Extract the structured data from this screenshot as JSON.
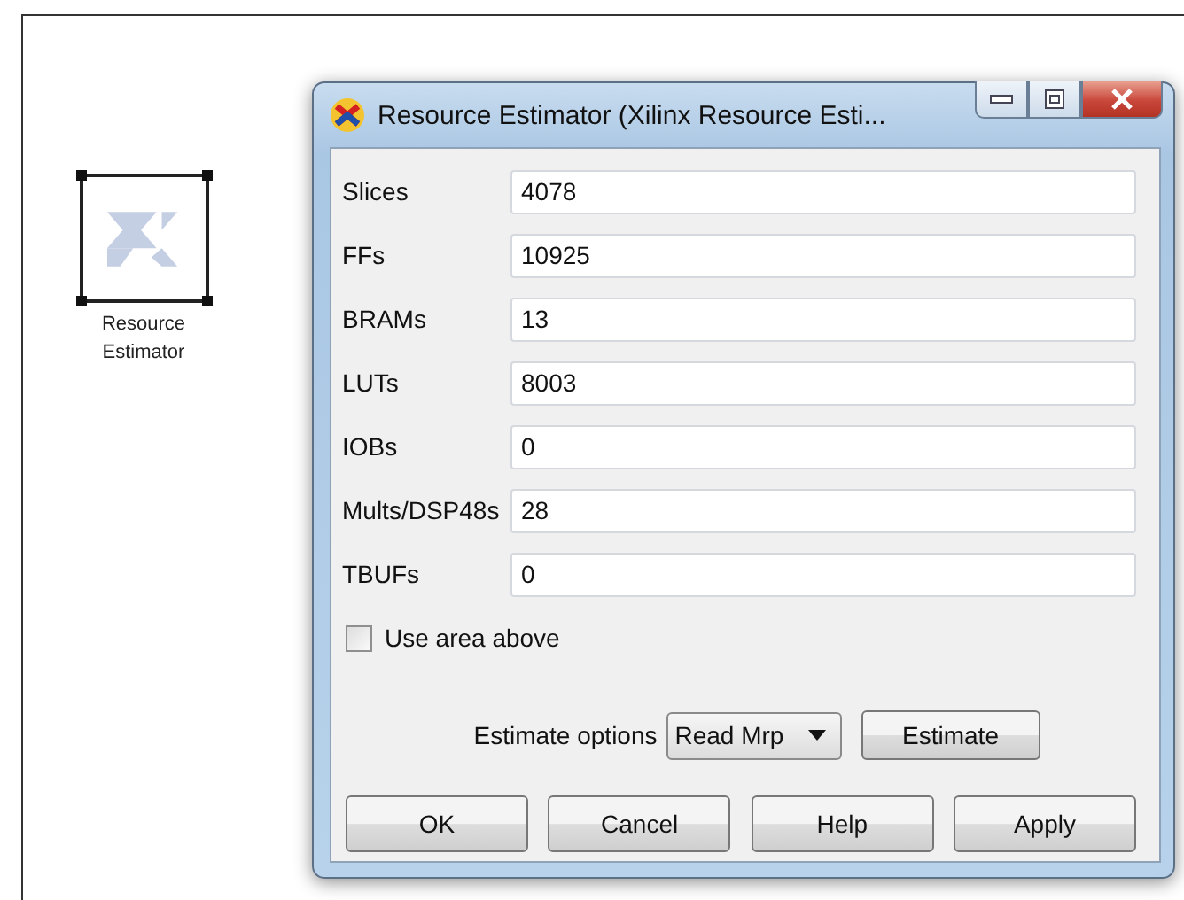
{
  "canvas_block": {
    "label_lines": [
      "Resource",
      "Estimator"
    ]
  },
  "window": {
    "title": "Resource Estimator (Xilinx Resource Esti..."
  },
  "fields": [
    {
      "label": "Slices",
      "value": "4078"
    },
    {
      "label": "FFs",
      "value": "10925"
    },
    {
      "label": "BRAMs",
      "value": "13"
    },
    {
      "label": "LUTs",
      "value": "8003"
    },
    {
      "label": "IOBs",
      "value": "0"
    },
    {
      "label": "Mults/DSP48s",
      "value": "28"
    },
    {
      "label": "TBUFs",
      "value": "0"
    }
  ],
  "use_area_above": {
    "label": "Use area above",
    "checked": false
  },
  "estimate": {
    "label": "Estimate options",
    "option": "Read Mrp",
    "button": "Estimate"
  },
  "buttons": [
    "OK",
    "Cancel",
    "Help",
    "Apply"
  ]
}
